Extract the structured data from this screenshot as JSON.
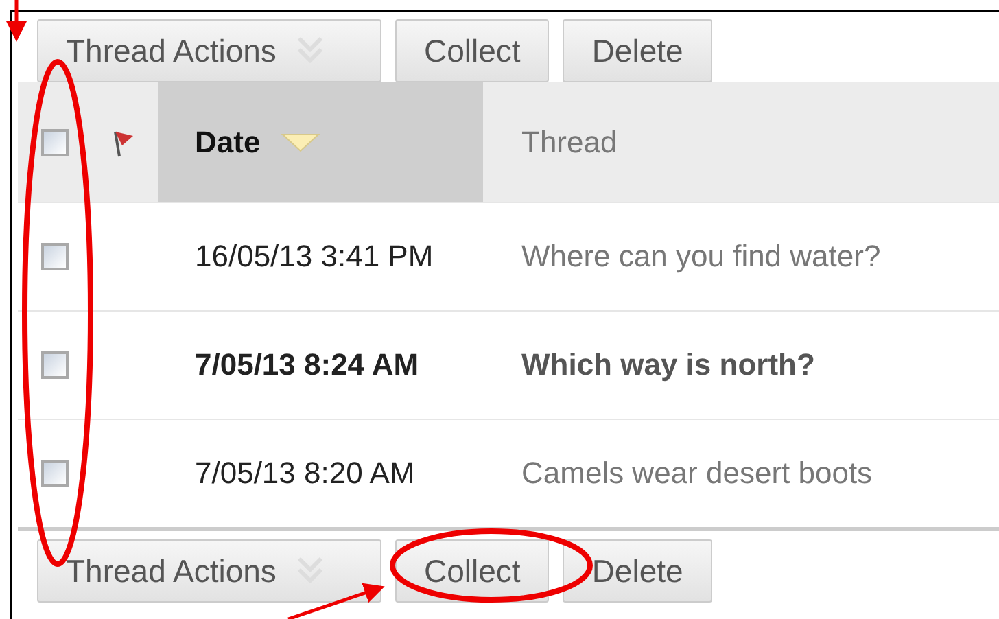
{
  "top_toolbar": {
    "buttons": [
      {
        "label": "Thread Actions",
        "kind": "menu"
      },
      {
        "label": "Collect",
        "kind": "plain"
      },
      {
        "label": "Delete",
        "kind": "plain"
      }
    ]
  },
  "table": {
    "select_all": {
      "checked": false
    },
    "columns": [
      {
        "label": "Date",
        "sorted": true
      },
      {
        "label": "Thread",
        "sorted": false
      }
    ],
    "rows": [
      {
        "checked": false,
        "unread": false,
        "date": "16/05/13 3:41 PM",
        "thread": "Where can you find water?"
      },
      {
        "checked": false,
        "unread": true,
        "date": "7/05/13 8:24 AM",
        "thread": "Which way is north?"
      },
      {
        "checked": false,
        "unread": false,
        "date": "7/05/13 8:20 AM",
        "thread": "Camels wear desert boots"
      }
    ]
  },
  "bottom_toolbar": {
    "buttons": [
      {
        "label": "Thread Actions",
        "kind": "menu"
      },
      {
        "label": "Collect",
        "kind": "plain"
      },
      {
        "label": "Delete",
        "kind": "plain"
      }
    ]
  }
}
